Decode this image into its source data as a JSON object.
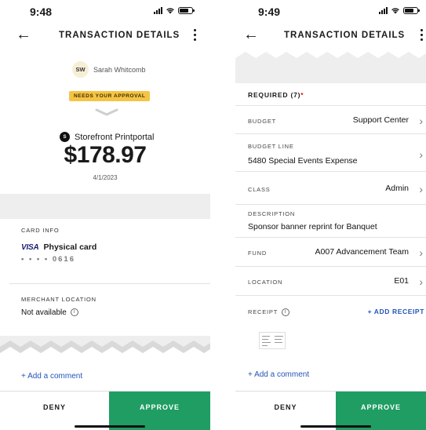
{
  "left": {
    "status_time": "9:48",
    "nav_title": "TRANSACTION DETAILS",
    "sender": {
      "initials": "SW",
      "name": "Sarah Whitcomb"
    },
    "badge": "NEEDS YOUR APPROVAL",
    "merchant": {
      "logo_letter": "S",
      "name": "Storefront Printportal"
    },
    "amount": "$178.97",
    "date": "4/1/2023",
    "card_info": {
      "label": "CARD INFO",
      "brand": "VISA",
      "type": "Physical card",
      "number": "• • • •   0616"
    },
    "merchant_location": {
      "label": "MERCHANT LOCATION",
      "value": "Not available",
      "icon": "info-icon"
    },
    "add_comment": "+ Add a comment",
    "deny": "DENY",
    "approve": "APPROVE"
  },
  "right": {
    "status_time": "9:49",
    "nav_title": "TRANSACTION DETAILS",
    "required": {
      "label": "REQUIRED",
      "count": "(7)",
      "star": "*"
    },
    "fields": [
      {
        "label": "BUDGET",
        "value": "Support Center"
      },
      {
        "label": "BUDGET LINE",
        "value": "5480 Special Events Expense"
      },
      {
        "label": "CLASS",
        "value": "Admin"
      },
      {
        "label": "DESCRIPTION",
        "value": "Sponsor banner reprint for Banquet"
      },
      {
        "label": "FUND",
        "value": "A007 Advancement Team"
      },
      {
        "label": "LOCATION",
        "value": "E01"
      }
    ],
    "receipt": {
      "label": "RECEIPT",
      "icon": "info-icon",
      "add_label": "+ ADD RECEIPT"
    },
    "add_comment": "+ Add a comment",
    "deny": "DENY",
    "approve": "APPROVE"
  },
  "colors": {
    "approve_green": "#1f9d63",
    "badge_yellow": "#f5c445",
    "link_blue": "#2255b8",
    "required_red": "#dd1111"
  }
}
